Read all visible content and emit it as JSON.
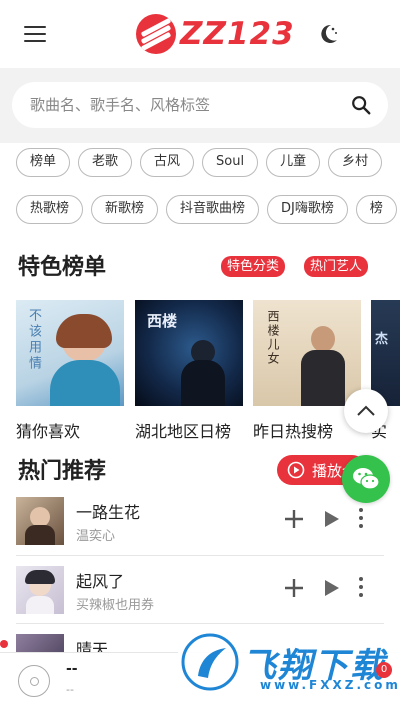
{
  "app": {
    "logo_text": "ZZ123"
  },
  "search": {
    "placeholder": "歌曲名、歌手名、风格标签"
  },
  "tags_row1": [
    "榜单",
    "老歌",
    "古风",
    "Soul",
    "儿童",
    "乡村"
  ],
  "tags_row2": [
    "热歌榜",
    "新歌榜",
    "抖音歌曲榜",
    "DJ嗨歌榜",
    "榜"
  ],
  "featured": {
    "title": "特色榜单",
    "pill_category": "特色分类",
    "pill_artists": "热门艺人",
    "cards": [
      {
        "label": "猜你喜欢",
        "cover_text": "不该用情"
      },
      {
        "label": "湖北地区日榜",
        "cover_text": "西楼"
      },
      {
        "label": "昨日热搜榜",
        "cover_text": "西楼儿女"
      },
      {
        "label": "实",
        "cover_text": "杰"
      }
    ]
  },
  "hot": {
    "title": "热门推荐",
    "play_all": "播放全部",
    "songs": [
      {
        "title": "一路生花",
        "artist": "温奕心"
      },
      {
        "title": "起风了",
        "artist": "买辣椒也用券"
      },
      {
        "title": "晴天",
        "artist": ""
      }
    ]
  },
  "player": {
    "title": "--",
    "subtitle": "--"
  },
  "watermark": {
    "title": "飞翔下载",
    "url": "www.FXXZ.com"
  },
  "badge": {
    "count": "0"
  },
  "colors": {
    "accent": "#e8323c",
    "wechat": "#35c24c",
    "watermark": "#1f86d6"
  }
}
